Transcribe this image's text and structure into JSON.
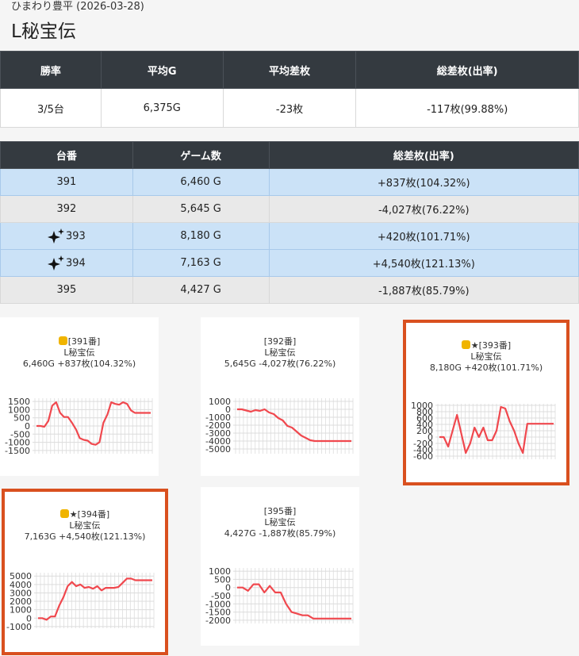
{
  "store_line": "ひまわり豊平 (2026-03-28)",
  "machine_name": "L秘宝伝",
  "summary": {
    "headers": [
      "勝率",
      "平均G",
      "平均差枚",
      "総差枚(出率)"
    ],
    "values": [
      "3/5台",
      "6,375G",
      "-23枚",
      "-117枚(99.88%)"
    ]
  },
  "machines": {
    "headers": [
      "台番",
      "ゲーム数",
      "総差枚(出率)"
    ],
    "rows": [
      {
        "no": "391",
        "games": "6,460 G",
        "diff": "+837枚(104.32%)",
        "style": "blue",
        "sparkle": false
      },
      {
        "no": "392",
        "games": "5,645 G",
        "diff": "-4,027枚(76.22%)",
        "style": "gray",
        "sparkle": false
      },
      {
        "no": "393",
        "games": "8,180 G",
        "diff": "+420枚(101.71%)",
        "style": "blue",
        "sparkle": true
      },
      {
        "no": "394",
        "games": "7,163 G",
        "diff": "+4,540枚(121.13%)",
        "style": "blue",
        "sparkle": true
      },
      {
        "no": "395",
        "games": "4,427 G",
        "diff": "-1,887枚(85.79%)",
        "style": "gray",
        "sparkle": false
      }
    ]
  },
  "chart_data": [
    {
      "type": "line",
      "title": "[391番]",
      "name": "L秘宝伝",
      "stats": "6,460G +837枚(104.32%)",
      "thumb": true,
      "star": false,
      "highlight": false,
      "yticks": [
        1500,
        1000,
        500,
        0,
        -500,
        -1000,
        -1500
      ],
      "ylim": [
        -1700,
        1700
      ],
      "values": [
        0,
        0,
        -50,
        300,
        1250,
        1450,
        800,
        550,
        550,
        200,
        -200,
        -750,
        -850,
        -900,
        -1100,
        -1150,
        -1000,
        200,
        700,
        1450,
        1350,
        1300,
        1450,
        1350,
        950,
        800,
        800,
        800,
        800,
        800
      ]
    },
    {
      "type": "line",
      "title": "[392番]",
      "name": "L秘宝伝",
      "stats": "5,645G -4,027枚(76.22%)",
      "thumb": false,
      "star": false,
      "highlight": false,
      "yticks": [
        1000,
        0,
        -1000,
        -2000,
        -3000,
        -4000,
        -5000
      ],
      "ylim": [
        -5600,
        1400
      ],
      "values": [
        0,
        0,
        -150,
        -300,
        -100,
        -200,
        0,
        -400,
        -600,
        -1100,
        -1400,
        -2100,
        -2300,
        -2800,
        -3300,
        -3600,
        -3900,
        -4000,
        -4000,
        -4000,
        -4000,
        -4000,
        -4000,
        -4000,
        -4000,
        -4000
      ]
    },
    {
      "type": "line",
      "title": "[393番]",
      "name": "L秘宝伝",
      "stats": "8,180G +420枚(101.71%)",
      "thumb": true,
      "star": true,
      "highlight": true,
      "yticks": [
        1000,
        800,
        600,
        400,
        200,
        0,
        -200,
        -400,
        -600
      ],
      "ylim": [
        -700,
        1050
      ],
      "values": [
        0,
        0,
        -300,
        200,
        700,
        100,
        -500,
        -200,
        300,
        0,
        300,
        -100,
        -100,
        200,
        950,
        900,
        500,
        200,
        -200,
        -500,
        420,
        420,
        420,
        420,
        420,
        420,
        420
      ]
    },
    {
      "type": "line",
      "title": "[394番]",
      "name": "L秘宝伝",
      "stats": "7,163G +4,540枚(121.13%)",
      "thumb": true,
      "star": true,
      "highlight": true,
      "yticks": [
        5000,
        4000,
        3000,
        2000,
        1000,
        0,
        -1000
      ],
      "ylim": [
        -1200,
        5400
      ],
      "values": [
        0,
        0,
        -200,
        200,
        200,
        1500,
        2500,
        3800,
        4300,
        3800,
        4000,
        3600,
        3700,
        3500,
        3800,
        3300,
        3600,
        3600,
        3600,
        3700,
        4200,
        4700,
        4700,
        4500,
        4500,
        4500,
        4500,
        4500
      ]
    },
    {
      "type": "line",
      "title": "[395番]",
      "name": "L秘宝伝",
      "stats": "4,427G -1,887枚(85.79%)",
      "thumb": false,
      "star": false,
      "highlight": false,
      "yticks": [
        1000,
        500,
        0,
        -500,
        -1000,
        -1500,
        -2000
      ],
      "ylim": [
        -2200,
        1200
      ],
      "values": [
        0,
        0,
        -200,
        200,
        200,
        -300,
        100,
        -300,
        -300,
        -1000,
        -1500,
        -1600,
        -1700,
        -1700,
        -1900,
        -1900,
        -1900,
        -1900,
        -1900,
        -1900,
        -1900,
        -1900
      ]
    }
  ]
}
